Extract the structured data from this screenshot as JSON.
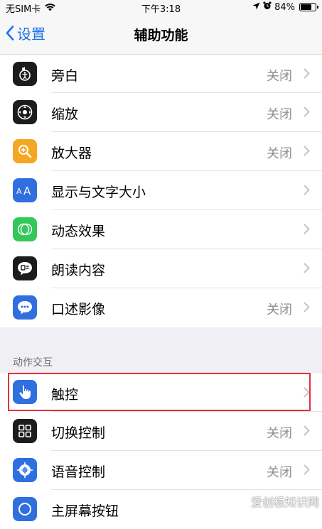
{
  "status_bar": {
    "carrier": "无SIM卡",
    "time": "下午3:18",
    "battery": "84%",
    "battery_level": 84
  },
  "nav": {
    "back_label": "设置",
    "title": "辅助功能"
  },
  "vision": {
    "items": [
      {
        "label": "旁白",
        "value": "关闭",
        "icon": "voiceover-icon",
        "color": "#1c1c1e"
      },
      {
        "label": "缩放",
        "value": "关闭",
        "icon": "zoom-icon",
        "color": "#1c1c1e"
      },
      {
        "label": "放大器",
        "value": "关闭",
        "icon": "magnifier-icon",
        "color": "#f5a623"
      },
      {
        "label": "显示与文字大小",
        "value": "",
        "icon": "text-size-icon",
        "color": "#2f6fe0"
      },
      {
        "label": "动态效果",
        "value": "",
        "icon": "motion-icon",
        "color": "#34c759"
      },
      {
        "label": "朗读内容",
        "value": "",
        "icon": "spoken-content-icon",
        "color": "#1c1c1e"
      },
      {
        "label": "口述影像",
        "value": "关闭",
        "icon": "audio-description-icon",
        "color": "#2f6fe0"
      }
    ]
  },
  "interaction": {
    "header": "动作交互",
    "items": [
      {
        "label": "触控",
        "value": "",
        "icon": "touch-icon",
        "color": "#2f6fe0"
      },
      {
        "label": "切换控制",
        "value": "关闭",
        "icon": "switch-control-icon",
        "color": "#1c1c1e"
      },
      {
        "label": "语音控制",
        "value": "关闭",
        "icon": "voice-control-icon",
        "color": "#2f6fe0"
      },
      {
        "label": "主屏幕按钮",
        "value": "",
        "icon": "home-button-icon",
        "color": "#2f6fe0"
      }
    ]
  },
  "watermark": "爱创根知识网"
}
